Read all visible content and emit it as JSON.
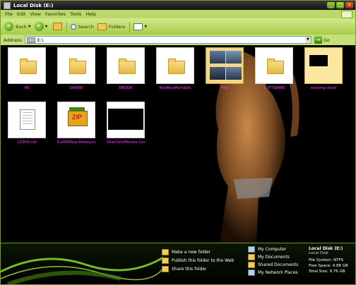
{
  "window": {
    "title": "Local Disk (E:)"
  },
  "titlebar": {
    "min": "_",
    "max": "□",
    "close": "×"
  },
  "menu": [
    "File",
    "Edit",
    "View",
    "Favorites",
    "Tools",
    "Help"
  ],
  "toolbar": {
    "back": "Back",
    "search": "Search",
    "folders": "Folders"
  },
  "address": {
    "label": "Address",
    "value": "E:\\",
    "go": "Go"
  },
  "files": [
    {
      "name": "45",
      "kind": "folder"
    },
    {
      "name": "DABBE",
      "kind": "folder"
    },
    {
      "name": "EBOOK",
      "kind": "folder"
    },
    {
      "name": "KeePassPortable",
      "kind": "folder"
    },
    {
      "name": "IMG",
      "kind": "photos"
    },
    {
      "name": "SOFTWARE",
      "kind": "folder"
    },
    {
      "name": "winamp devil",
      "kind": "winamp"
    },
    {
      "name": "123HS.txt",
      "kind": "txt"
    },
    {
      "name": "EuMARSav3rdrequired...",
      "kind": "zip"
    },
    {
      "name": "OneClickMovies.Com...",
      "kind": "video"
    }
  ],
  "tasks": [
    "Make a new folder",
    "Publish this folder to the Web",
    "Share this folder"
  ],
  "places": [
    "My Computer",
    "My Documents",
    "Shared Documents",
    "My Network Places"
  ],
  "details": {
    "title": "Local Disk (E:)",
    "subtitle": "Local Disk",
    "filesystem": "File System: NTFS",
    "free": "Free Space: 4.88 GB",
    "total": "Total Size: 9.76 GB"
  },
  "colors": {
    "accent": "#8fbe2c",
    "label": "#ff33ff",
    "background": "#000000"
  }
}
